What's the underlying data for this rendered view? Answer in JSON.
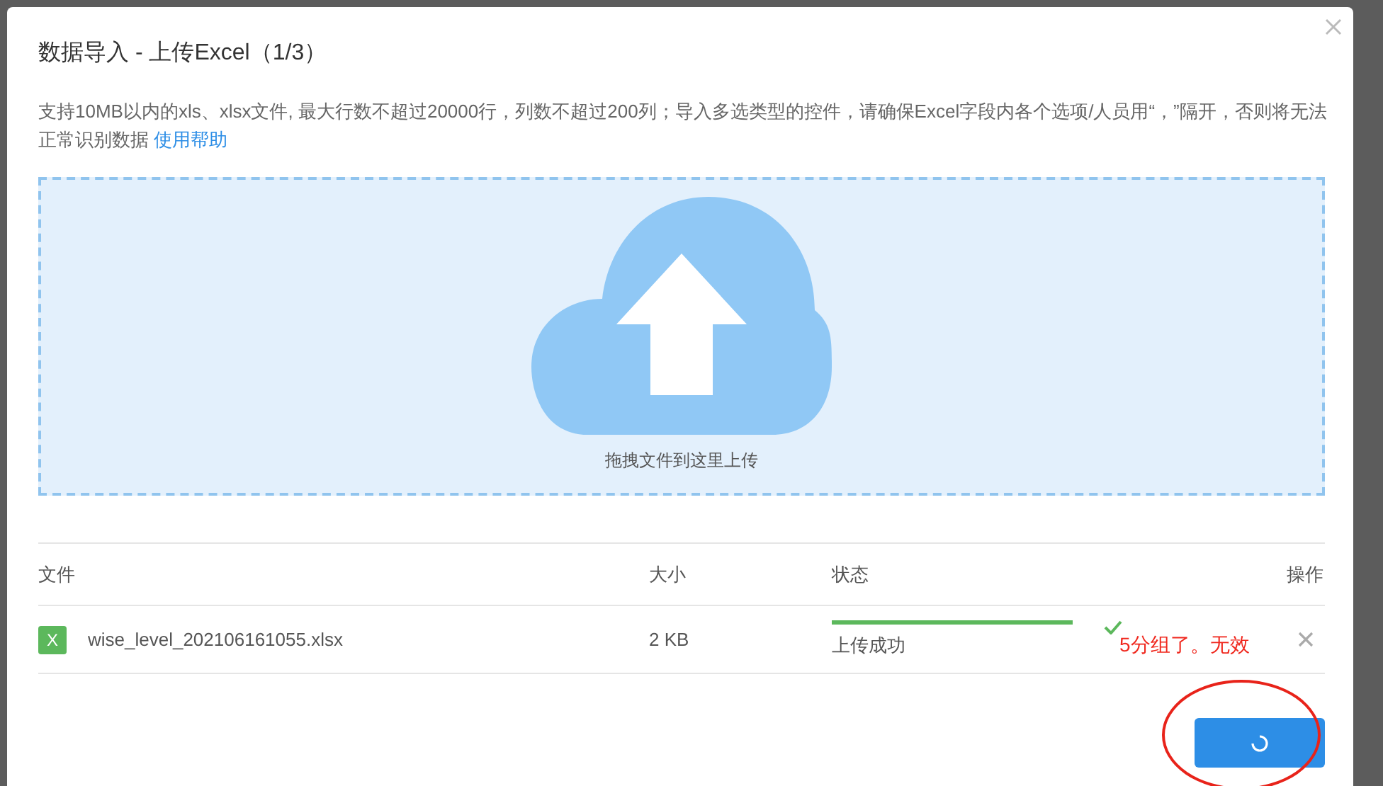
{
  "dialog": {
    "title": "数据导入 - 上传Excel（1/3）",
    "notice": "支持10MB以内的xls、xlsx文件, 最大行数不超过20000行，列数不超过200列；导入多选类型的控件，请确保Excel字段内各个选项/人员用“，”隔开，否则将无法正常识别数据",
    "help_link": "使用帮助",
    "dropzone": {
      "hint": "拖拽文件到这里上传"
    },
    "table": {
      "columns": [
        "文件",
        "大小",
        "状态",
        "操作"
      ],
      "rows": [
        {
          "file_icon": "X",
          "file": "wise_level_202106161055.xlsx",
          "size": "2 KB",
          "level": 1,
          "status": "上传成功",
          "done": true
        }
      ]
    },
    "submit": {
      "loading": true
    }
  },
  "annotation": {
    "text": "5分组了。无效"
  }
}
